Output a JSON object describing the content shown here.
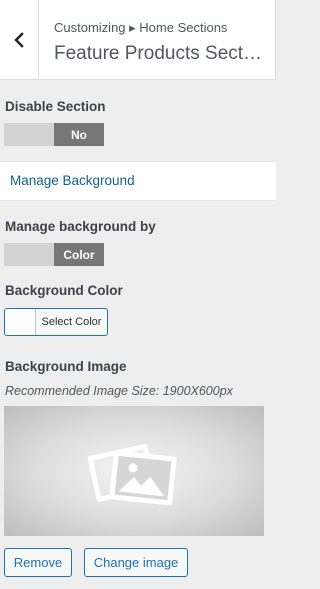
{
  "header": {
    "back_icon": "chevron-left-icon",
    "breadcrumb": "Customizing ▸ Home Sections",
    "title": "Feature Products Sect…"
  },
  "disable_section": {
    "label": "Disable Section",
    "toggle_value": "No"
  },
  "manage_background_link": "Manage Background",
  "manage_background_by": {
    "label": "Manage background by",
    "toggle_value": "Color"
  },
  "background_color": {
    "label": "Background Color",
    "button_label": "Select Color",
    "current_color": "#ffffff"
  },
  "background_image": {
    "label": "Background Image",
    "hint": "Recommended Image Size: 1900X600px",
    "placeholder_icon": "image-placeholder-icon",
    "remove_label": "Remove",
    "change_label": "Change image"
  },
  "colors": {
    "accent": "#2271b1",
    "link": "#135e96",
    "toggle_active": "#777777",
    "toggle_inactive": "#d3d3d3"
  }
}
